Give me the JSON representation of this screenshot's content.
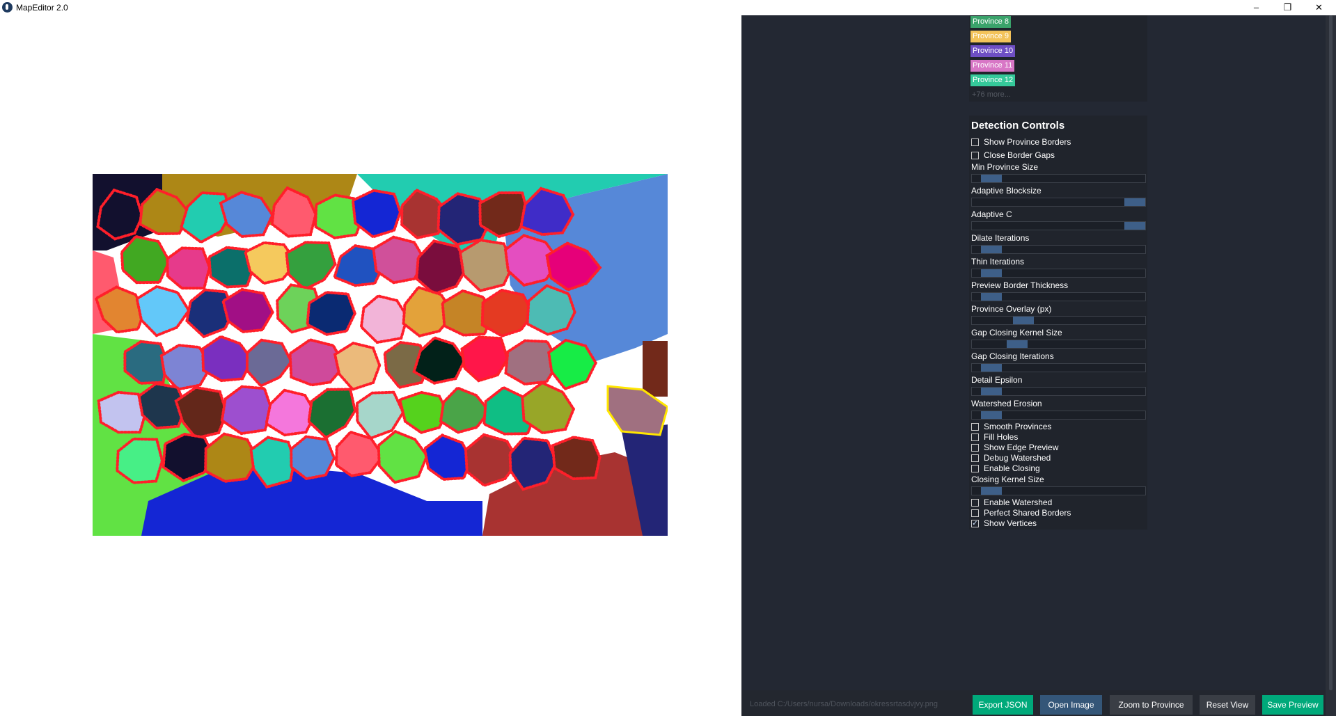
{
  "window": {
    "title": "MapEditor 2.0",
    "minimize": "–",
    "maximize": "❐",
    "close": "✕"
  },
  "province_list": {
    "items": [
      {
        "label": "Province 8",
        "color": "#3aa36b"
      },
      {
        "label": "Province 9",
        "color": "#f3c35a"
      },
      {
        "label": "Province 10",
        "color": "#6e4fc4"
      },
      {
        "label": "Province 11",
        "color": "#d877c6"
      },
      {
        "label": "Province 12",
        "color": "#35c99a"
      }
    ],
    "more": "+76 more..."
  },
  "controls": {
    "title": "Detection Controls",
    "top_checks": [
      {
        "label": "Show Province Borders",
        "checked": false
      },
      {
        "label": "Close Border Gaps",
        "checked": false
      }
    ],
    "sliders": [
      {
        "label": "Min Province Size",
        "value": 0.06
      },
      {
        "label": "Adaptive Blocksize",
        "value": 1.0
      },
      {
        "label": "Adaptive C",
        "value": 1.0
      },
      {
        "label": "Dilate Iterations",
        "value": 0.06
      },
      {
        "label": "Thin Iterations",
        "value": 0.06
      },
      {
        "label": "Preview Border Thickness",
        "value": 0.06
      },
      {
        "label": "Province Overlay (px)",
        "value": 0.27
      },
      {
        "label": "Gap Closing Kernel Size",
        "value": 0.23
      },
      {
        "label": "Gap Closing Iterations",
        "value": 0.06
      },
      {
        "label": "Detail Epsilon",
        "value": 0.06
      },
      {
        "label": "Watershed Erosion",
        "value": 0.06
      }
    ],
    "mid_checks": [
      {
        "label": "Smooth Provinces",
        "checked": false
      },
      {
        "label": "Fill Holes",
        "checked": false
      },
      {
        "label": "Show Edge Preview",
        "checked": false
      },
      {
        "label": "Debug Watershed",
        "checked": false
      },
      {
        "label": "Enable Closing",
        "checked": false
      }
    ],
    "closing_slider": {
      "label": "Closing Kernel Size",
      "value": 0.06
    },
    "bottom_checks": [
      {
        "label": "Enable Watershed",
        "checked": false
      },
      {
        "label": "Perfect Shared Borders",
        "checked": false
      },
      {
        "label": "Show Vertices",
        "checked": true
      }
    ]
  },
  "status": "Loaded C:/Users/nursa/Downloads/okressrtasdvjvy.png",
  "buttons": {
    "export_json": "Export JSON",
    "open_image": "Open Image",
    "zoom_province": "Zoom to Province",
    "reset_view": "Reset View",
    "save_preview": "Save Preview"
  },
  "colors": {
    "accent_green": "#00a97a",
    "accent_blue": "#345678",
    "neutral_button": "#3a3e45",
    "panel_bg": "#232833"
  },
  "map": {
    "province_colors": [
      "#12102e",
      "#ad8716",
      "#22ccb0",
      "#5688d8",
      "#ff5a6e",
      "#61e244",
      "#1426d4",
      "#a83331",
      "#232576",
      "#72291a",
      "#3f2cc8",
      "#41a822",
      "#e63a8b",
      "#0b6f6a",
      "#f5c95d",
      "#34a03e",
      "#2052c0",
      "#d0509a",
      "#7a0d3d",
      "#b79a6f",
      "#e44ec0",
      "#e60079",
      "#e28530",
      "#63c8f9",
      "#1a2f79",
      "#a10f85",
      "#6dd25a",
      "#0a2a72",
      "#f2b4d8",
      "#e3a23a",
      "#c58426",
      "#e43a22",
      "#4dbbb4",
      "#2a6b80",
      "#7d84d4",
      "#7a2fbf",
      "#6b6a96",
      "#cf4a9b",
      "#ebba7b",
      "#7b6a46",
      "#022119",
      "#ff1649",
      "#a07080",
      "#17ec46",
      "#c2c3ef",
      "#1e364d",
      "#63271a",
      "#9d4fcf",
      "#f477dc",
      "#1b6f32",
      "#a6d6ca",
      "#55d21d",
      "#4aa448",
      "#0fbe84",
      "#98a628",
      "#47ef86"
    ]
  }
}
